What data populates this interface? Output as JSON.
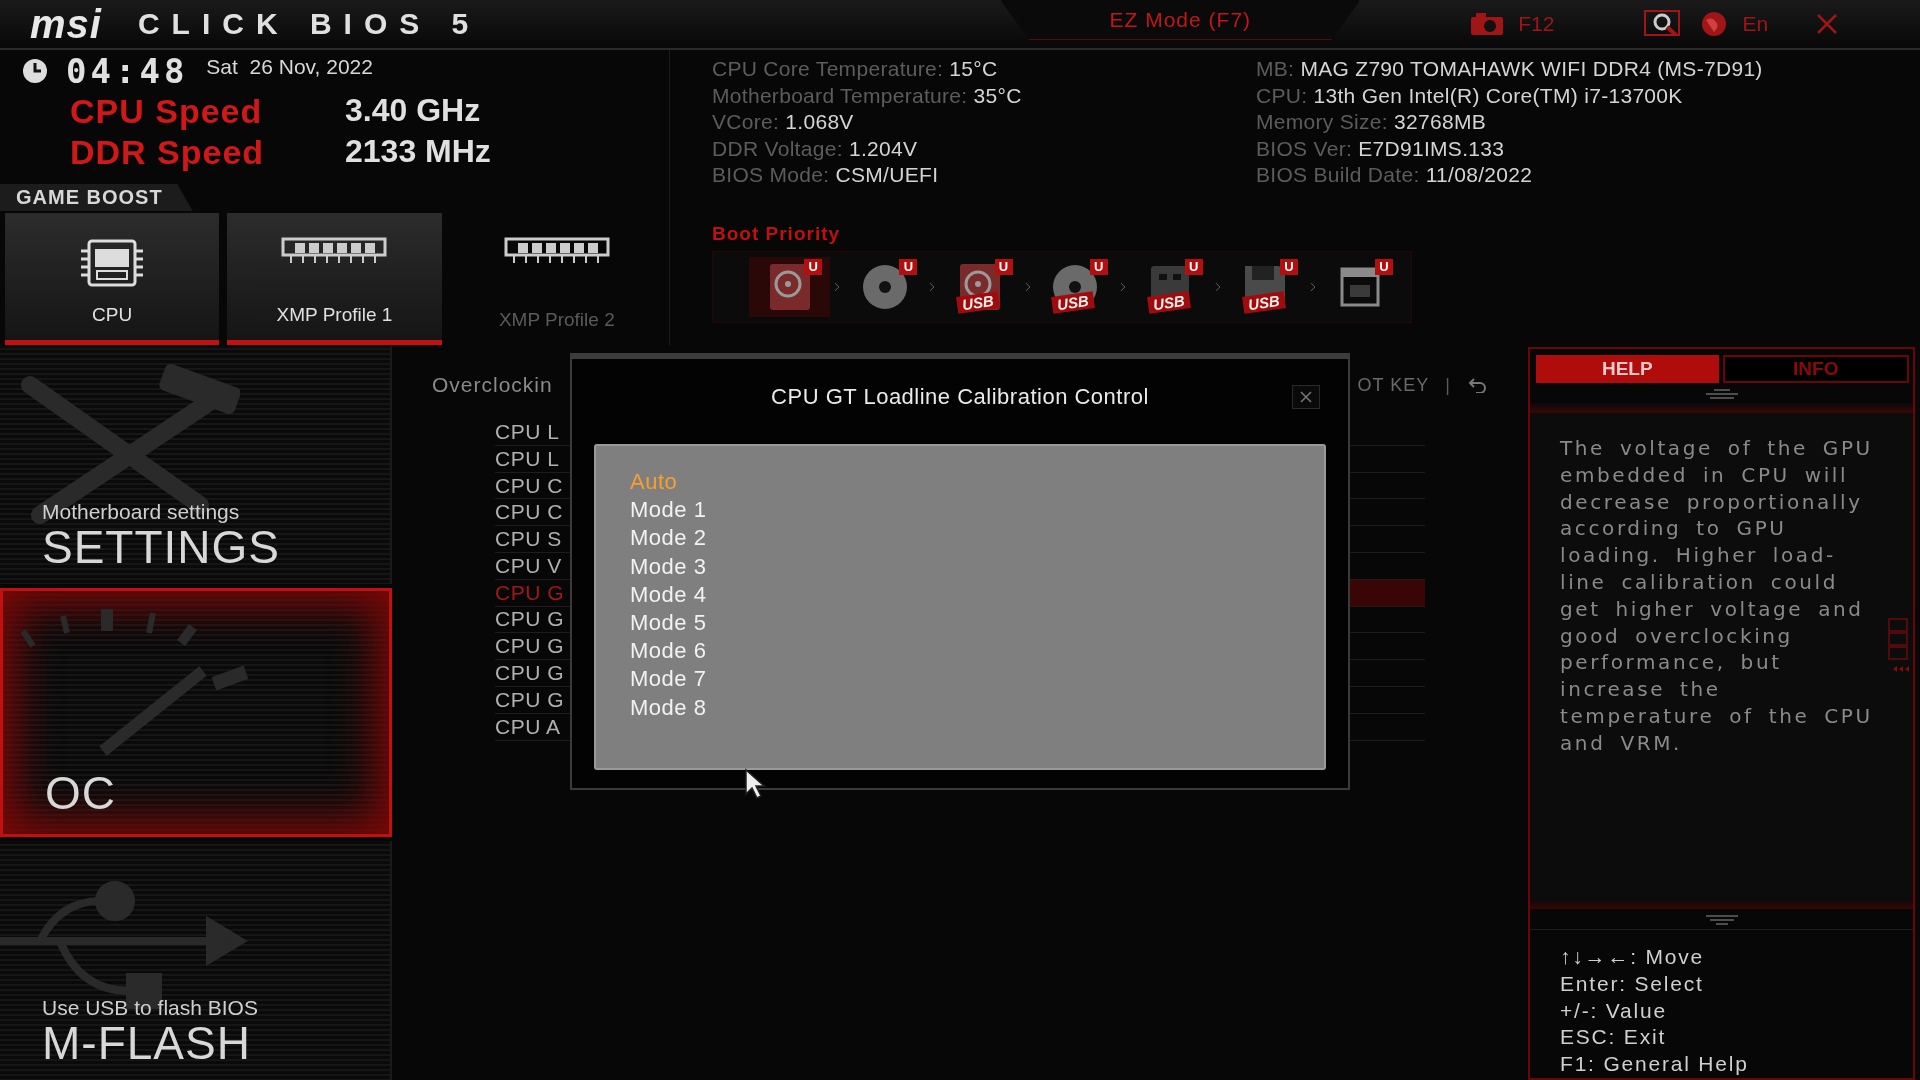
{
  "top_bar": {
    "logo": "msi",
    "title": "CLICK BIOS 5",
    "mode_button": "EZ Mode (F7)",
    "screenshot_key": "F12",
    "language": "En"
  },
  "clock": {
    "time": "04:48",
    "date": "Sat  26 Nov, 2022"
  },
  "speeds": [
    {
      "label": "CPU Speed",
      "value": "3.40",
      "unit": "GHz"
    },
    {
      "label": "DDR Speed",
      "value": "2133",
      "unit": "MHz"
    }
  ],
  "system_info": [
    [
      {
        "label": "CPU Core Temperature:",
        "value": "15°C"
      },
      {
        "label": "Motherboard Temperature:",
        "value": "35°C"
      },
      {
        "label": "VCore:",
        "value": "1.068V"
      },
      {
        "label": "DDR Voltage:",
        "value": "1.204V"
      },
      {
        "label": "BIOS Mode:",
        "value": "CSM/UEFI"
      }
    ],
    [
      {
        "label": "MB:",
        "value": "MAG Z790 TOMAHAWK WIFI DDR4 (MS-7D91)"
      },
      {
        "label": "CPU:",
        "value": "13th Gen Intel(R) Core(TM) i7-13700K"
      },
      {
        "label": "Memory Size:",
        "value": "32768MB"
      },
      {
        "label": "BIOS Ver:",
        "value": "E7D91IMS.133"
      },
      {
        "label": "BIOS Build Date:",
        "value": "11/08/2022"
      }
    ]
  ],
  "game_boost": {
    "title": "GAME BOOST",
    "profiles": [
      {
        "kind": "cpu",
        "label": "CPU",
        "disabled": false
      },
      {
        "kind": "memory",
        "label": "XMP Profile 1",
        "disabled": false
      },
      {
        "kind": "memory",
        "label": "XMP Profile 2",
        "disabled": true
      }
    ]
  },
  "boot_priority": {
    "title": "Boot Priority",
    "devices": [
      {
        "kind": "hdd",
        "badge": "U",
        "selected": true
      },
      {
        "kind": "disc",
        "badge": "U",
        "selected": false
      },
      {
        "kind": "hdd",
        "badge": "U",
        "label": "USB",
        "selected": false
      },
      {
        "kind": "disc",
        "badge": "U",
        "label": "USB",
        "selected": false
      },
      {
        "kind": "key",
        "badge": "U",
        "label": "USB",
        "selected": false
      },
      {
        "kind": "floppy",
        "badge": "U",
        "label": "USB",
        "selected": false
      },
      {
        "kind": "network",
        "badge": "U",
        "selected": false
      }
    ]
  },
  "nav": [
    {
      "kind": "settings",
      "caption": "Motherboard settings",
      "label": "SETTINGS",
      "selected": false
    },
    {
      "kind": "oc",
      "label": "OC",
      "selected": true
    },
    {
      "kind": "mflash",
      "caption": "Use USB to flash BIOS",
      "label": "M-FLASH",
      "selected": false
    }
  ],
  "overclocking": {
    "title": "Overclockin",
    "hotkey": "OT KEY",
    "separator": "|",
    "items": [
      {
        "label": "CPU L",
        "selected": false
      },
      {
        "label": "CPU L",
        "selected": false
      },
      {
        "label": "CPU C",
        "selected": false
      },
      {
        "label": "CPU C",
        "selected": false
      },
      {
        "label": "CPU S",
        "selected": false
      },
      {
        "label": "CPU V",
        "selected": false
      },
      {
        "label": "CPU G",
        "selected": true
      },
      {
        "label": "CPU G",
        "selected": false
      },
      {
        "label": "CPU G",
        "selected": false
      },
      {
        "label": "CPU G",
        "selected": false
      },
      {
        "label": "CPU G",
        "selected": false
      },
      {
        "label": "CPU A",
        "selected": false
      }
    ]
  },
  "dialog": {
    "title": "CPU GT Loadline Calibration Control",
    "options": [
      {
        "label": "Auto",
        "selected": true
      },
      {
        "label": "Mode 1",
        "selected": false
      },
      {
        "label": "Mode 2",
        "selected": false
      },
      {
        "label": "Mode 3",
        "selected": false
      },
      {
        "label": "Mode 4",
        "selected": false
      },
      {
        "label": "Mode 5",
        "selected": false
      },
      {
        "label": "Mode 6",
        "selected": false
      },
      {
        "label": "Mode 7",
        "selected": false
      },
      {
        "label": "Mode 8",
        "selected": false
      }
    ]
  },
  "help_panel": {
    "tabs": [
      {
        "label": "HELP",
        "selected": true
      },
      {
        "label": "INFO",
        "selected": false
      }
    ],
    "text": "The voltage of the GPU embedded in CPU will decrease proportionally according to GPU loading. Higher load-line calibration could get higher voltage and good overclocking performance, but increase the temperature of the CPU and VRM.",
    "keys": [
      "↑↓→←: Move",
      "Enter: Select",
      "+/-: Value",
      "ESC: Exit",
      "F1: General Help"
    ]
  }
}
